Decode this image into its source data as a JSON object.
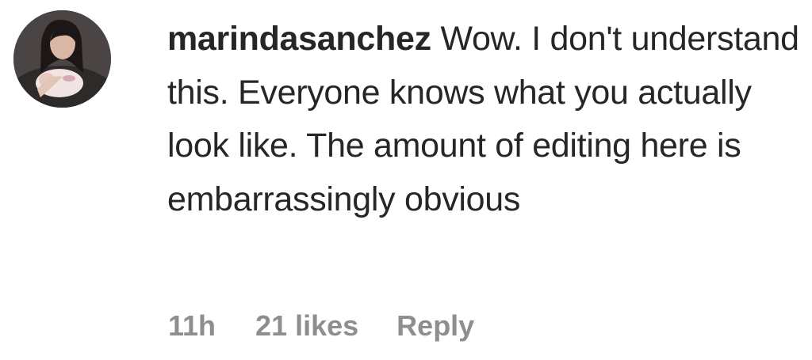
{
  "comment": {
    "username": "marindasanchez",
    "text": "Wow. I don't understand this. Everyone knows what you actually look like. The amount of editing here is embarrassingly obvious",
    "time": "11h",
    "likes": "21 likes",
    "reply_label": "Reply"
  }
}
